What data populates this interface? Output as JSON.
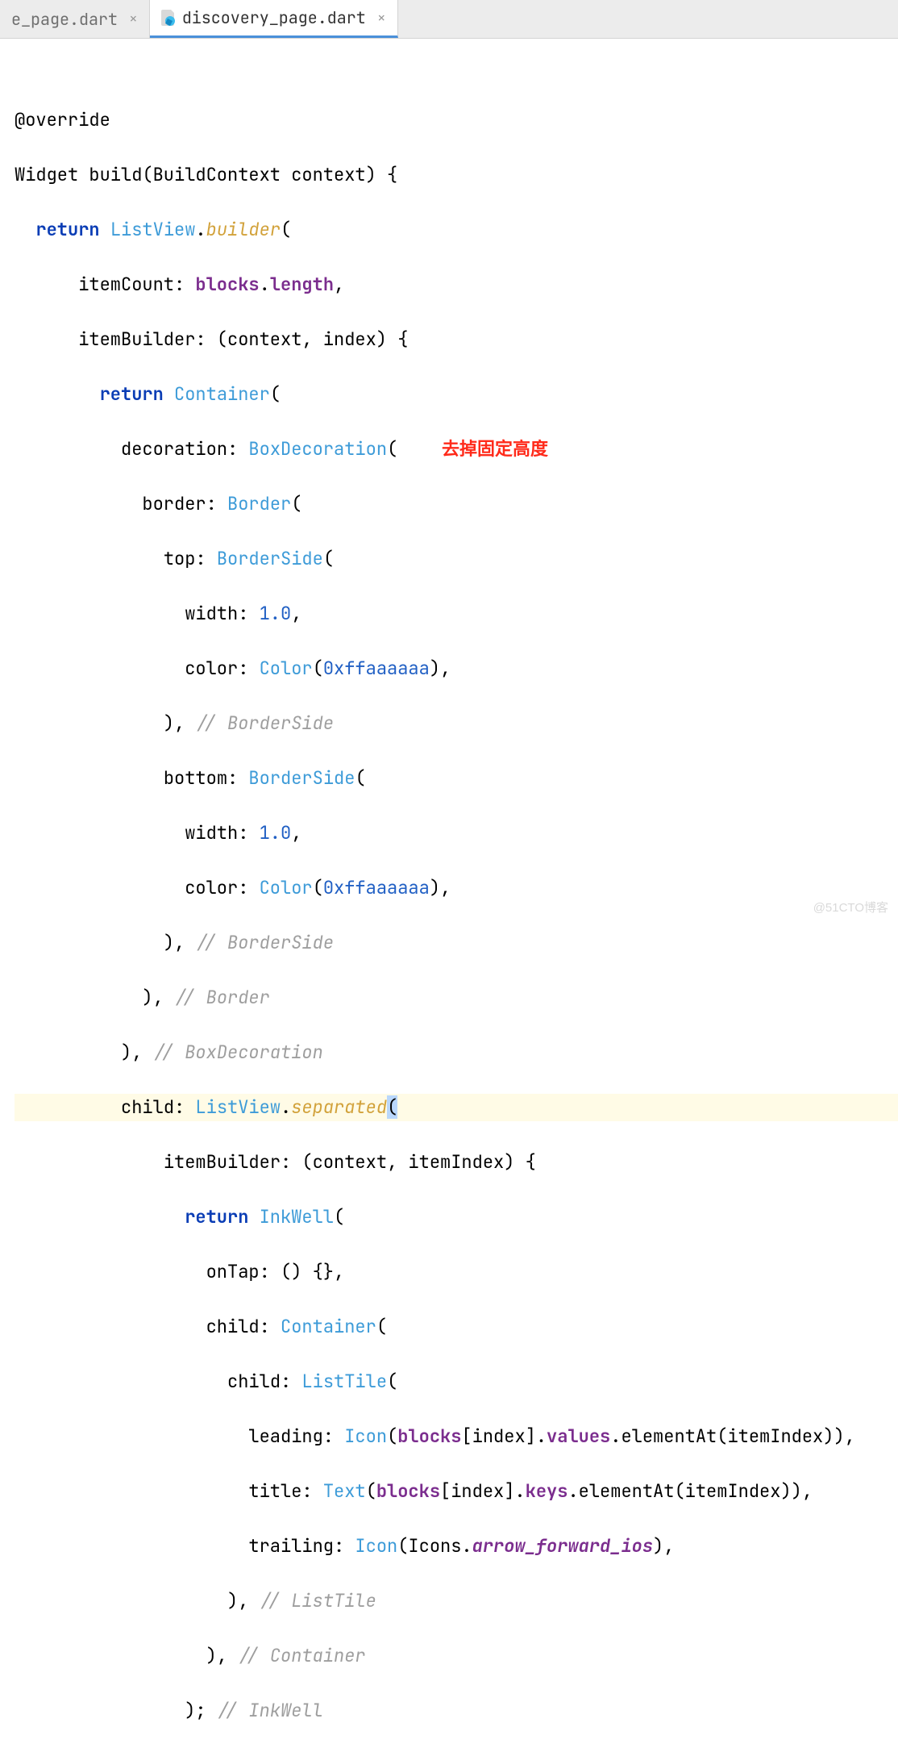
{
  "tabs": [
    {
      "label": "e_page.dart",
      "active": false
    },
    {
      "label": "discovery_page.dart",
      "active": true
    }
  ],
  "annotation": "去掉固定高度",
  "watermark": "@51CTO博客",
  "code": {
    "l1a": "@override",
    "l2a": "Widget build(BuildContext context) {",
    "l3_kw": "return",
    "l3_t": "ListView",
    "l3_m": "builder",
    "l4a": "itemCount: ",
    "l4b": "blocks",
    "l4c": ".",
    "l4d": "length",
    "l4e": ",",
    "l5a": "itemBuilder: (context, index) {",
    "l6_kw": "return",
    "l6_t": "Container",
    "l7a": "decoration: ",
    "l7_t": "BoxDecoration",
    "l8a": "border: ",
    "l8_t": "Border",
    "l9a": "top: ",
    "l9_t": "BorderSide",
    "l10a": "width: ",
    "l10_n": "1.0",
    "l10c": ",",
    "l11a": "color: ",
    "l11_t": "Color",
    "l11_hex": "0xffaaaaaa",
    "l11d": "),",
    "l12a": "), ",
    "l12_c": "// BorderSide",
    "l13a": "bottom: ",
    "l13_t": "BorderSide",
    "l14a": "width: ",
    "l14_n": "1.0",
    "l14c": ",",
    "l15a": "color: ",
    "l15_t": "Color",
    "l15_hex": "0xffaaaaaa",
    "l15d": "),",
    "l16a": "), ",
    "l16_c": "// BorderSide",
    "l17a": "), ",
    "l17_c": "// Border",
    "l18a": "), ",
    "l18_c": "// BoxDecoration",
    "l19a": "child: ",
    "l19_t": "ListView",
    "l19_m": "separated",
    "l20a": "itemBuilder: (context, itemIndex) {",
    "l21_kw": "return",
    "l21_t": "InkWell",
    "l22a": "onTap: () {},",
    "l23a": "child: ",
    "l23_t": "Container",
    "l24a": "child: ",
    "l24_t": "ListTile",
    "l25a": "leading: ",
    "l25_t": "Icon",
    "l25b": "(",
    "l25c": "blocks",
    "l25d": "[index].",
    "l25e": "values",
    "l25f": ".elementAt(itemIndex)),",
    "l26a": "title: ",
    "l26_t": "Text",
    "l26b": "(",
    "l26c": "blocks",
    "l26d": "[index].",
    "l26e": "keys",
    "l26f": ".elementAt(itemIndex)),",
    "l27a": "trailing: ",
    "l27_t": "Icon",
    "l27b": "(Icons.",
    "l27c": "arrow_forward_ios",
    "l27d": "),",
    "l28a": "), ",
    "l28_c": "// ListTile",
    "l29a": "), ",
    "l29_c": "// Container",
    "l30a": "); ",
    "l30_c": "// InkWell"
  }
}
